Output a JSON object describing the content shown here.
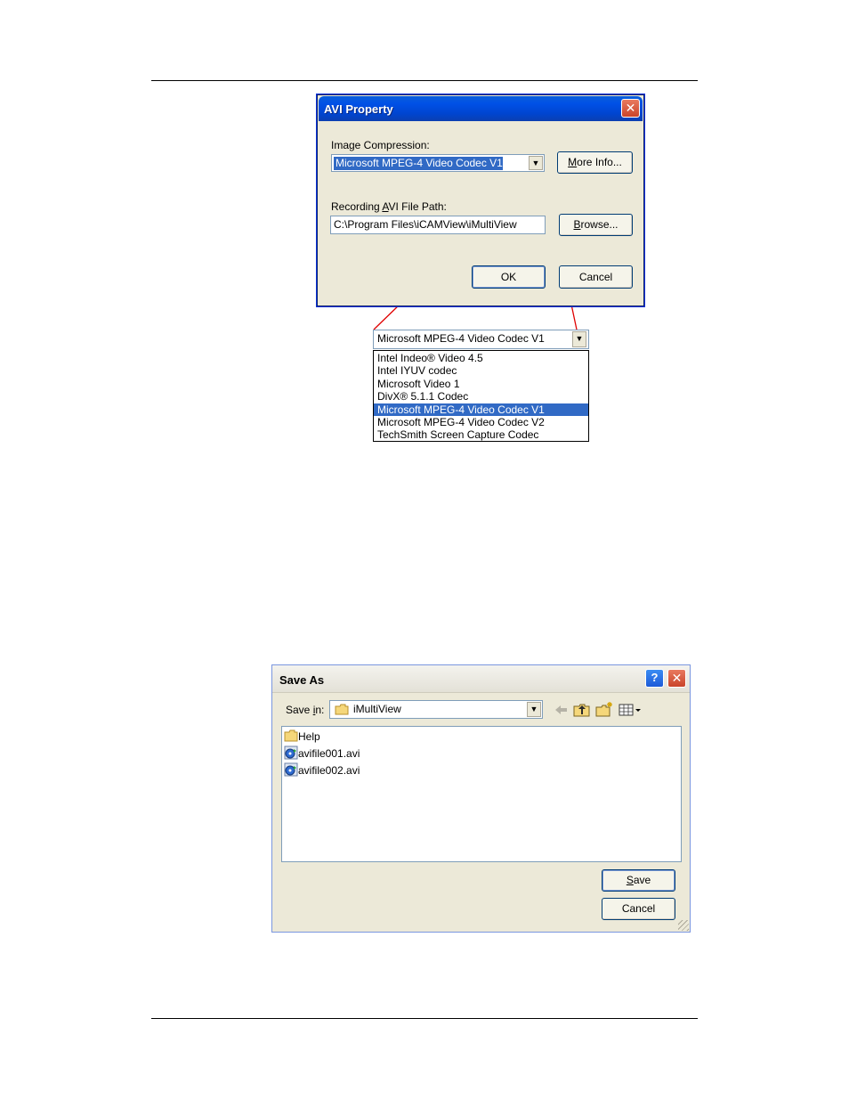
{
  "avi_dialog": {
    "title": "AVI Property",
    "image_compression_label_pre": "Image Compression:",
    "selected_codec": "Microsoft MPEG-4 Video Codec V1",
    "more_info_pre": "M",
    "more_info_rest": "ore Info...",
    "path_label_pre": "Recording ",
    "path_label_u": "A",
    "path_label_post": "VI File Path:",
    "path_value": "C:\\Program Files\\iCAMView\\iMultiView",
    "browse_pre": "B",
    "browse_rest": "rowse...",
    "ok_label": "OK",
    "cancel_label": "Cancel"
  },
  "codec_dropdown": {
    "selected": "Microsoft MPEG-4 Video Codec V1",
    "options": [
      "Intel Indeo® Video 4.5",
      "Intel IYUV codec",
      "Microsoft Video 1",
      "DivX® 5.1.1 Codec",
      "Microsoft MPEG-4 Video Codec V1",
      "Microsoft MPEG-4 Video Codec V2",
      "TechSmith Screen Capture Codec"
    ],
    "selected_index": 4
  },
  "save_as": {
    "title": "Save As",
    "help_glyph": "?",
    "save_in_label_pre": "Save ",
    "save_in_label_u": "i",
    "save_in_label_post": "n:",
    "folder": "iMultiView",
    "files": [
      {
        "name": "Help",
        "icon": "folder-icon"
      },
      {
        "name": "avifile001.avi",
        "icon": "media-file-icon"
      },
      {
        "name": "avifile002.avi",
        "icon": "media-file-icon"
      }
    ],
    "save_pre": "S",
    "save_rest": "ave",
    "cancel_label": "Cancel"
  }
}
